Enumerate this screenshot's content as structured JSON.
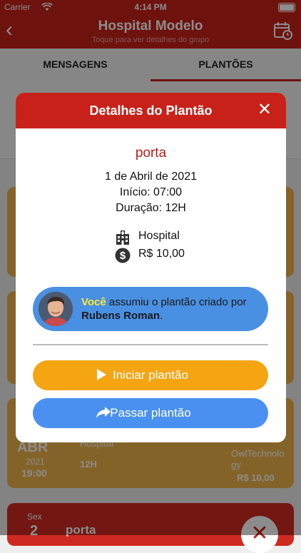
{
  "status_bar": {
    "carrier": "Carrier",
    "time": "4:14 PM"
  },
  "header": {
    "title": "Hospital Modelo",
    "subtitle": "Toque para ver detalhes do grupo"
  },
  "tabs": [
    {
      "label": "MENSAGENS"
    },
    {
      "label": "PLANTÕES",
      "active": true
    }
  ],
  "background": {
    "card_month": "ABR",
    "card_year": "2021",
    "card_time": "19:00",
    "card_place": "Hospital",
    "card_duration": "12H",
    "card_org": "OwlTechnolo gy",
    "card_value": "R$ 10,00",
    "next_day": "Sex",
    "next_date": "2",
    "next_title": "porta"
  },
  "modal": {
    "title": "Detalhes do Plantão",
    "place": "porta",
    "date": "1 de Abril de 2021",
    "start": "Início: 07:00",
    "duration": "Duração: 12H",
    "location": "Hospital",
    "value": "R$ 10,00",
    "assignment": {
      "you": "Você",
      "middle": " assumiu o plantão criado por ",
      "creator": "Rubens Roman",
      "end": "."
    },
    "start_button": "Iniciar plantão",
    "pass_button": "Passar plantão"
  },
  "colors": {
    "primary": "#c8211a",
    "orange": "#f5a412",
    "blue": "#4a90f0",
    "card": "#f0b44c"
  }
}
